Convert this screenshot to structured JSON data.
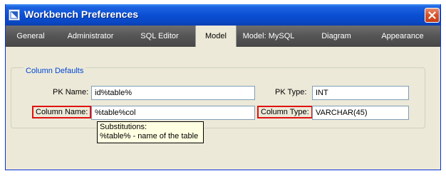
{
  "window": {
    "title": "Workbench Preferences"
  },
  "tabs": [
    {
      "label": "General"
    },
    {
      "label": "Administrator"
    },
    {
      "label": "SQL Editor"
    },
    {
      "label": "Model",
      "active": true
    },
    {
      "label": "Model: MySQL"
    },
    {
      "label": "Diagram"
    },
    {
      "label": "Appearance"
    }
  ],
  "column_defaults": {
    "group_title": "Column Defaults",
    "pk_name_label": "PK Name:",
    "pk_name_value": "id%table%",
    "pk_type_label": "PK Type:",
    "pk_type_value": "INT",
    "column_name_label": "Column Name:",
    "column_name_value": "%table%col",
    "column_type_label": "Column Type:",
    "column_type_value": "VARCHAR(45)"
  },
  "tooltip": {
    "line1": "Substitutions:",
    "line2": "%table% - name of the table"
  },
  "colors": {
    "titlebar": "#0b4fd4",
    "tabbar": "#555555",
    "dialog_bg": "#ece9d8",
    "highlight_border": "#e01010",
    "group_title": "#0046d5",
    "tooltip_bg": "#ffffe1"
  },
  "icons": {
    "app": "workbench-app-icon",
    "close": "close-icon"
  }
}
